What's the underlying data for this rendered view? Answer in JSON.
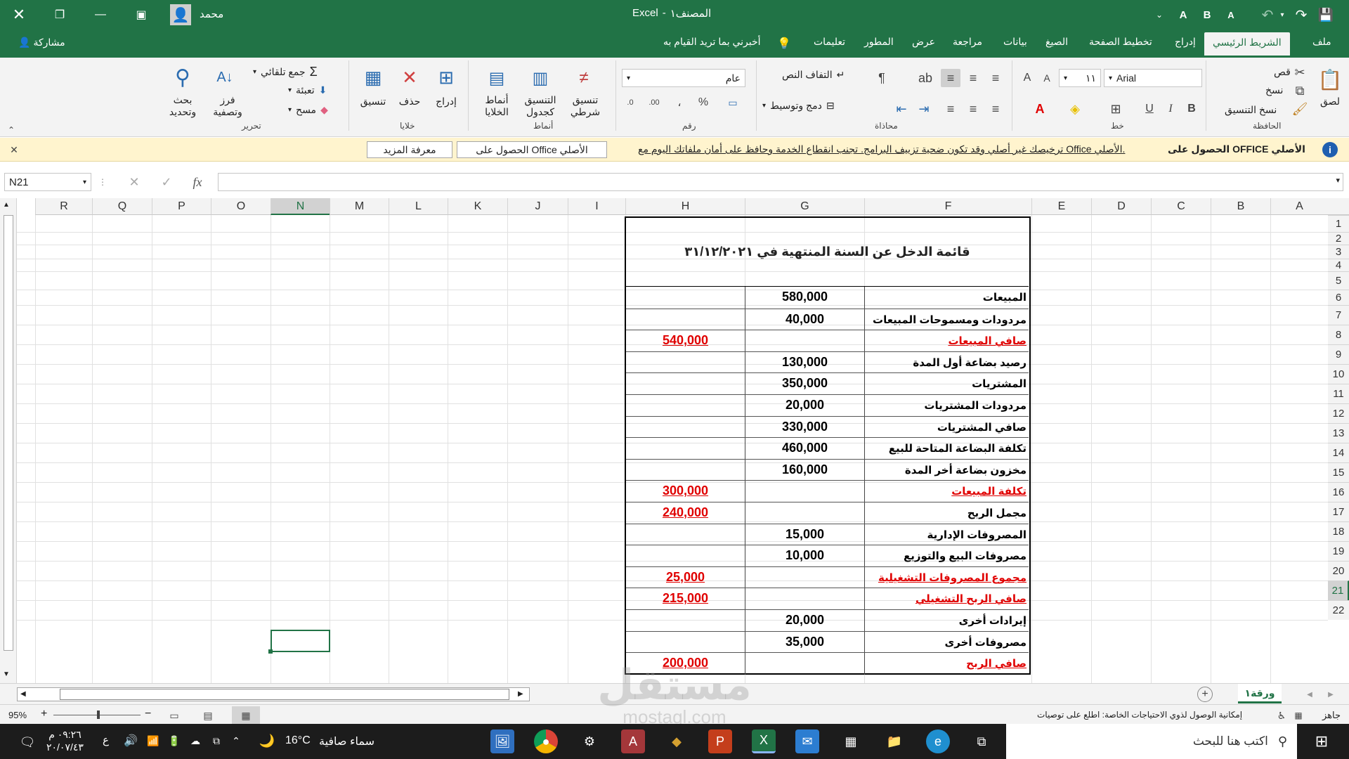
{
  "title": {
    "workbook": "المصنف١",
    "app": "Excel",
    "sep": "-",
    "user": "محمد"
  },
  "qat": {
    "save": "💾",
    "redo": "↷",
    "undo": "↶",
    "font_a_large": "A",
    "font_b": "B",
    "font_a_small": "A"
  },
  "tabs": {
    "file": "ملف",
    "home": "الشريط الرئيسي",
    "insert": "إدراج",
    "page_layout": "تخطيط الصفحة",
    "formulas": "الصيغ",
    "data": "بيانات",
    "review": "مراجعة",
    "view": "عرض",
    "developer": "المطور",
    "help": "تعليمات",
    "tell_me": "أخبرني بما تريد القيام به",
    "share": "مشاركة"
  },
  "ribbon": {
    "clipboard": {
      "label": "الحافظة",
      "paste": "لصق",
      "cut": "قص",
      "copy": "نسخ",
      "format_painter": "نسخ التنسيق"
    },
    "font": {
      "label": "خط",
      "font_name": "Arial",
      "font_size": "١١",
      "bold": "B",
      "italic": "I",
      "underline": "U"
    },
    "alignment": {
      "label": "محاذاة",
      "wrap": "التفاف النص",
      "merge": "دمج وتوسيط"
    },
    "number": {
      "label": "رقم",
      "format": "عام",
      "percent": "%",
      "comma": "،"
    },
    "styles": {
      "label": "أنماط",
      "conditional": "تنسيق شرطي",
      "as_table": "التنسيق كجدول",
      "cell_styles": "أنماط الخلايا"
    },
    "cells": {
      "label": "خلايا",
      "insert": "إدراج",
      "delete": "حذف",
      "format": "تنسيق"
    },
    "editing": {
      "label": "تحرير",
      "autosum": "جمع تلقائي",
      "fill": "تعبئة",
      "clear": "مسح",
      "sort": "فرز وتصفية",
      "find": "بحث وتحديد"
    }
  },
  "message_bar": {
    "title": "الحصول على OFFICE الأصلي",
    "text": "ترخيصك غير أصلي وقد تكون ضحية تزييف البرامج. تجنب انقطاع الخدمة وحافظ على أمان ملفاتك اليوم مع Office الأصلي.",
    "btn_genuine": "الحصول على Office الأصلي",
    "btn_learn": "معرفة المزيد"
  },
  "formula_bar": {
    "name_box": "N21",
    "fx": "fx",
    "value": ""
  },
  "columns": [
    "A",
    "B",
    "C",
    "D",
    "E",
    "F",
    "G",
    "H",
    "I",
    "J",
    "K",
    "L",
    "M",
    "N",
    "O",
    "P",
    "Q",
    "R"
  ],
  "rows": [
    "1",
    "2",
    "3",
    "4",
    "5",
    "6",
    "7",
    "8",
    "9",
    "10",
    "11",
    "12",
    "13",
    "14",
    "15",
    "16",
    "17",
    "18",
    "19",
    "20",
    "21",
    "22"
  ],
  "statement": {
    "title": "قائمة الدخل عن السنة المنتهية في ٣١/١٢/٢٠٢١",
    "lines": [
      {
        "label": "المبيعات",
        "g": "580,000",
        "h": "",
        "red": false
      },
      {
        "label": "مردودات ومسموحات المبيعات",
        "g": "40,000",
        "h": "",
        "red": false
      },
      {
        "label": "صافي المبيعات",
        "g": "",
        "h": "540,000",
        "red": true
      },
      {
        "label": "رصيد بضاعة أول المدة",
        "g": "130,000",
        "h": "",
        "red": false
      },
      {
        "label": "المشتريات",
        "g": "350,000",
        "h": "",
        "red": false
      },
      {
        "label": "مردودات المشتريات",
        "g": "20,000",
        "h": "",
        "red": false
      },
      {
        "label": "صافي المشتريات",
        "g": "330,000",
        "h": "",
        "red": false
      },
      {
        "label": "تكلفة البضاعة المتاحة للبيع",
        "g": "460,000",
        "h": "",
        "red": false
      },
      {
        "label": "مخزون بضاعة أخر المدة",
        "g": "160,000",
        "h": "",
        "red": false
      },
      {
        "label": "تكلفة المبيعات",
        "g": "",
        "h": "300,000",
        "red": true
      },
      {
        "label": "مجمل الربح",
        "g": "",
        "h": "240,000",
        "red": false,
        "hred": true
      },
      {
        "label": "المصروفات الإدارية",
        "g": "15,000",
        "h": "",
        "red": false
      },
      {
        "label": "مصروفات البيع والتوزيع",
        "g": "10,000",
        "h": "",
        "red": false
      },
      {
        "label": "مجموع المصروفات التشغيلية",
        "g": "",
        "h": "25,000",
        "red": true
      },
      {
        "label": "صافي الربح التشغيلي",
        "g": "",
        "h": "215,000",
        "red": true
      },
      {
        "label": "إيرادات أخرى",
        "g": "20,000",
        "h": "",
        "red": false
      },
      {
        "label": "مصروفات أخرى",
        "g": "35,000",
        "h": "",
        "red": false
      },
      {
        "label": "صافي الربح",
        "g": "",
        "h": "200,000",
        "red": true
      }
    ]
  },
  "sheet_tab": "ورقة١",
  "status": {
    "ready": "جاهز",
    "accessibility": "إمكانية الوصول لذوي الاحتياجات الخاصة: اطلع على توصيات",
    "zoom": "95%"
  },
  "taskbar": {
    "search": "اكتب هنا للبحث",
    "weather": "سماء صافية",
    "temp": "16°C",
    "time": "٠٩:٢٦ م",
    "date": "٢٠/٠٧/٤٣",
    "lang": "ع"
  },
  "watermark": {
    "brand": "مستقل",
    "url": "mostaql.com"
  },
  "colors": {
    "excel_green": "#217346",
    "accent_red": "#e00000",
    "msg_yellow": "#fff4ce"
  }
}
